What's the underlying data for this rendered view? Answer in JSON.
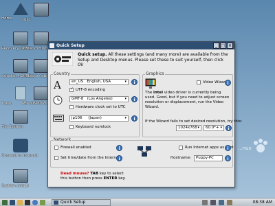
{
  "desktop": {
    "icons": [
      {
        "label": "Home"
      },
      {
        "label": "sda1"
      },
      {
        "label": "Recovery (sda1)"
      },
      {
        "label": "X-Slacko 5(sd..."
      },
      {
        "label": "xslacko_4.2 (sd..."
      },
      {
        "label": "X-Slacko (sdb3)"
      },
      {
        "label": "Trash"
      },
      {
        "label": "MS WINDOW..."
      },
      {
        "label": "File System"
      },
      {
        "label": "Connect to Internet"
      },
      {
        "label": "System (sda2)"
      }
    ],
    "wallpaper_text": "...nux"
  },
  "window": {
    "title": "Quick Setup",
    "header_text_bold": "Quick setup.",
    "header_text": "All these settings (and many more) are available from the Setup and Desktop menus. Please set these to suit yourself, then click",
    "header_ok": "Ok",
    "country": {
      "title": "Country",
      "locale_code": "en_US",
      "locale_name": "English, USA",
      "utf8_label": "UTF-8 encoding",
      "utf8_checked": true,
      "timezone_code": "GMT-8",
      "timezone_name": "(Los Angeles)",
      "hwclock_label": "Hardware clock set to UTC",
      "hwclock_checked": false,
      "keyboard_code": "jp106",
      "keyboard_name": "(Japan)",
      "numlock_label": "Keyboard numlock",
      "numlock_checked": false
    },
    "graphics": {
      "title": "Graphics",
      "wizard_label": "Video Wizard",
      "driver_pre": "The",
      "driver_bold": "intel",
      "driver_post": "video driver is currently being used. Good, but if you need to adjust screen resolution or displacement, run the Video Wizard.",
      "resolution_prompt": "If the Wizard fails to set desired resolution, try this:",
      "resolution": "1024x768",
      "refresh": "60.0*+"
    },
    "network": {
      "title": "Network",
      "firewall_label": "Firewall enabled",
      "timedate_label": "Set time/date from the Internet",
      "run_as_spot_label": "Run Internet apps as spot",
      "hostname_label": "Hostname:",
      "hostname_value": "Puppy-PC"
    },
    "footer_bold": "Dead mouse?",
    "footer_tab": "TAB",
    "footer_text1": "key to select",
    "footer_text2": "this button then press",
    "footer_enter": "ENTER",
    "footer_text3": "key."
  },
  "taskbar": {
    "task_label": "Quick Setup",
    "clock": "08:38 AM"
  }
}
